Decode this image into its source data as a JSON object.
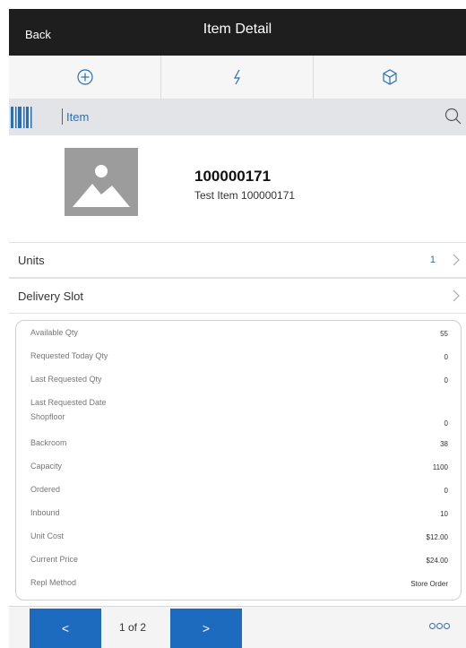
{
  "header": {
    "back_label": "Back",
    "title": "Item Detail"
  },
  "toolbar": {
    "actions": [
      {
        "icon": "plus-circle-icon"
      },
      {
        "icon": "lightning-icon"
      },
      {
        "icon": "box-icon"
      }
    ]
  },
  "search": {
    "label": "Item",
    "icon": "search-icon",
    "scan_icon": "barcode-icon"
  },
  "item": {
    "number": "100000171",
    "description": "Test Item 100000171",
    "image_icon": "image-placeholder-icon"
  },
  "rows": [
    {
      "label": "Units",
      "value": "1"
    },
    {
      "label": "Delivery Slot",
      "value": ""
    }
  ],
  "details": [
    {
      "label": "Available Qty",
      "value": "55"
    },
    {
      "label": "Requested Today Qty",
      "value": "0"
    },
    {
      "label": "Last Requested Qty",
      "value": "0"
    },
    {
      "label": "Last Requested Date",
      "value": ""
    },
    {
      "label": "Shopfloor",
      "value": "0"
    },
    {
      "label": "Backroom",
      "value": "38"
    },
    {
      "label": "Capacity",
      "value": "1100"
    },
    {
      "label": "Ordered",
      "value": "0"
    },
    {
      "label": "Inbound",
      "value": "10"
    },
    {
      "label": "Unit Cost",
      "value": "$12.00"
    },
    {
      "label": "Current Price",
      "value": "$24.00"
    },
    {
      "label": "Repl Method",
      "value": "Store Order"
    }
  ],
  "footer": {
    "prev_label": "<",
    "next_label": ">",
    "page_indicator": "1 of 2",
    "more_icon": "more-options-icon"
  },
  "colors": {
    "accent": "#1c6bbf",
    "header_bg": "#1e1e1e",
    "link": "#2b6fb3"
  }
}
